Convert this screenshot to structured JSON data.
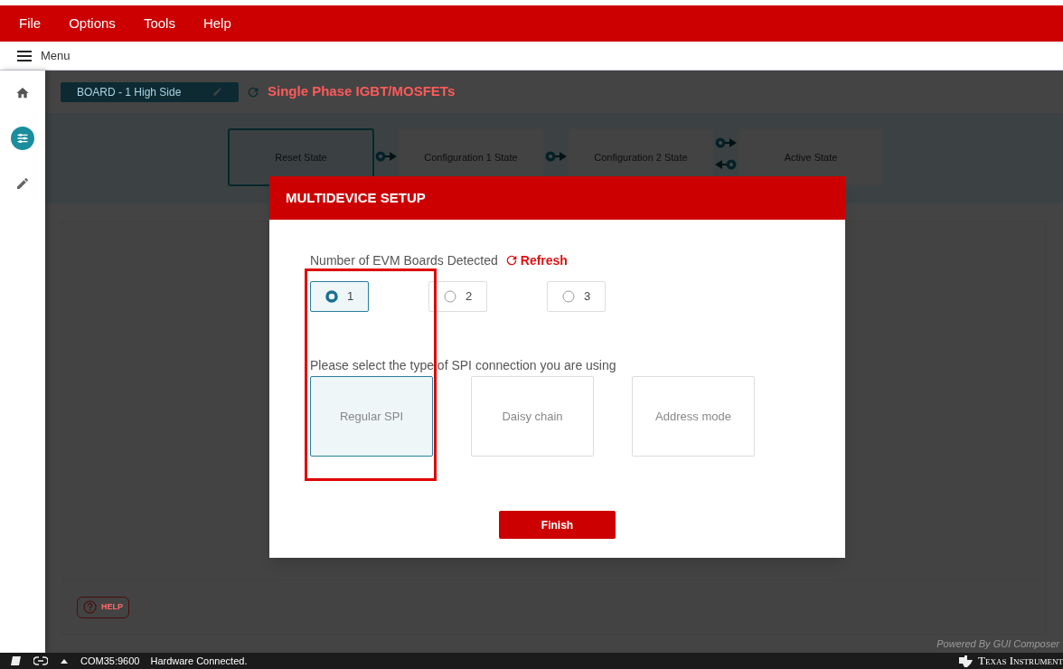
{
  "menu_bar": [
    "File",
    "Options",
    "Tools",
    "Help"
  ],
  "menu_toggle": {
    "label": "Menu"
  },
  "sidebar": {
    "items": [
      {
        "kind": "home",
        "selected": false
      },
      {
        "kind": "sliders",
        "selected": true
      },
      {
        "kind": "pencil",
        "selected": false
      }
    ]
  },
  "header": {
    "board_selector": "BOARD - 1 High Side",
    "title": "Single Phase IGBT/MOSFETs"
  },
  "state_diagram": {
    "states": [
      {
        "label": "Reset State",
        "selected": true
      },
      {
        "label": "Configuration 1 State",
        "selected": false
      },
      {
        "label": "Configuration 2 State",
        "selected": false
      },
      {
        "label": "Active State",
        "selected": false
      }
    ]
  },
  "help_button": "HELP",
  "powered_by": "Powered By GUI Composer",
  "dialog": {
    "title": "MULTIDEVICE SETUP",
    "boards_label": "Number of EVM Boards Detected",
    "refresh": "Refresh",
    "board_options": [
      {
        "label": "1",
        "selected": true
      },
      {
        "label": "2",
        "selected": false
      },
      {
        "label": "3",
        "selected": false
      }
    ],
    "spi_label": "Please select the type of SPI connection you are using",
    "spi_options": [
      {
        "label": "Regular SPI",
        "selected": true
      },
      {
        "label": "Daisy chain",
        "selected": false
      },
      {
        "label": "Address mode",
        "selected": false
      }
    ],
    "finish": "Finish"
  },
  "status_bar": {
    "port": "COM35:9600",
    "message": "Hardware Connected.",
    "brand": "Texas Instrument"
  }
}
